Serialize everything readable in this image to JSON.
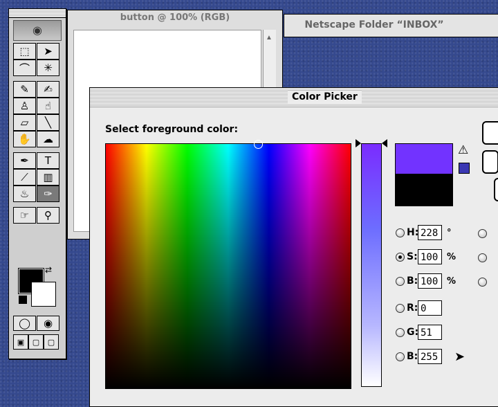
{
  "windows": {
    "document_title": "button @ 100% (RGB)",
    "netscape_title": "Netscape Folder “INBOX”"
  },
  "picker": {
    "title": "Color Picker",
    "prompt": "Select foreground color:",
    "new_color": "#7233ff",
    "old_color": "#000000",
    "warning_symbol": "⚠",
    "fields": [
      {
        "label": "H:",
        "value": "228",
        "unit": "°",
        "selected": false
      },
      {
        "label": "S:",
        "value": "100",
        "unit": "%",
        "selected": true
      },
      {
        "label": "B:",
        "value": "100",
        "unit": "%",
        "selected": false
      },
      {
        "label": "R:",
        "value": "0",
        "unit": "",
        "selected": false
      },
      {
        "label": "G:",
        "value": "51",
        "unit": "",
        "selected": false
      },
      {
        "label": "B:",
        "value": "255",
        "unit": "",
        "selected": false
      }
    ]
  },
  "toolbox": {
    "tools": [
      {
        "icon": "marquee-icon",
        "glyph": "⬚"
      },
      {
        "icon": "move-icon",
        "glyph": "➤"
      },
      {
        "icon": "lasso-icon",
        "glyph": "⌒"
      },
      {
        "icon": "magic-wand-icon",
        "glyph": "✳"
      },
      {
        "icon": "airbrush-icon",
        "glyph": "✎"
      },
      {
        "icon": "paintbrush-icon",
        "glyph": "✍"
      },
      {
        "icon": "rubber-stamp-icon",
        "glyph": "♙"
      },
      {
        "icon": "smudge-icon",
        "glyph": "☝"
      },
      {
        "icon": "eraser-icon",
        "glyph": "▱"
      },
      {
        "icon": "line-icon",
        "glyph": "╲"
      },
      {
        "icon": "dodge-icon",
        "glyph": "✋"
      },
      {
        "icon": "sponge-icon",
        "glyph": "☁"
      },
      {
        "icon": "pen-icon",
        "glyph": "✒"
      },
      {
        "icon": "type-icon",
        "glyph": "T"
      },
      {
        "icon": "measure-icon",
        "glyph": "⟋"
      },
      {
        "icon": "gradient-icon",
        "glyph": "▥"
      },
      {
        "icon": "paint-bucket-icon",
        "glyph": "♨"
      },
      {
        "icon": "eyedropper-icon",
        "glyph": "✑"
      },
      {
        "icon": "hand-icon",
        "glyph": "☞"
      },
      {
        "icon": "zoom-icon",
        "glyph": "⚲"
      }
    ]
  }
}
